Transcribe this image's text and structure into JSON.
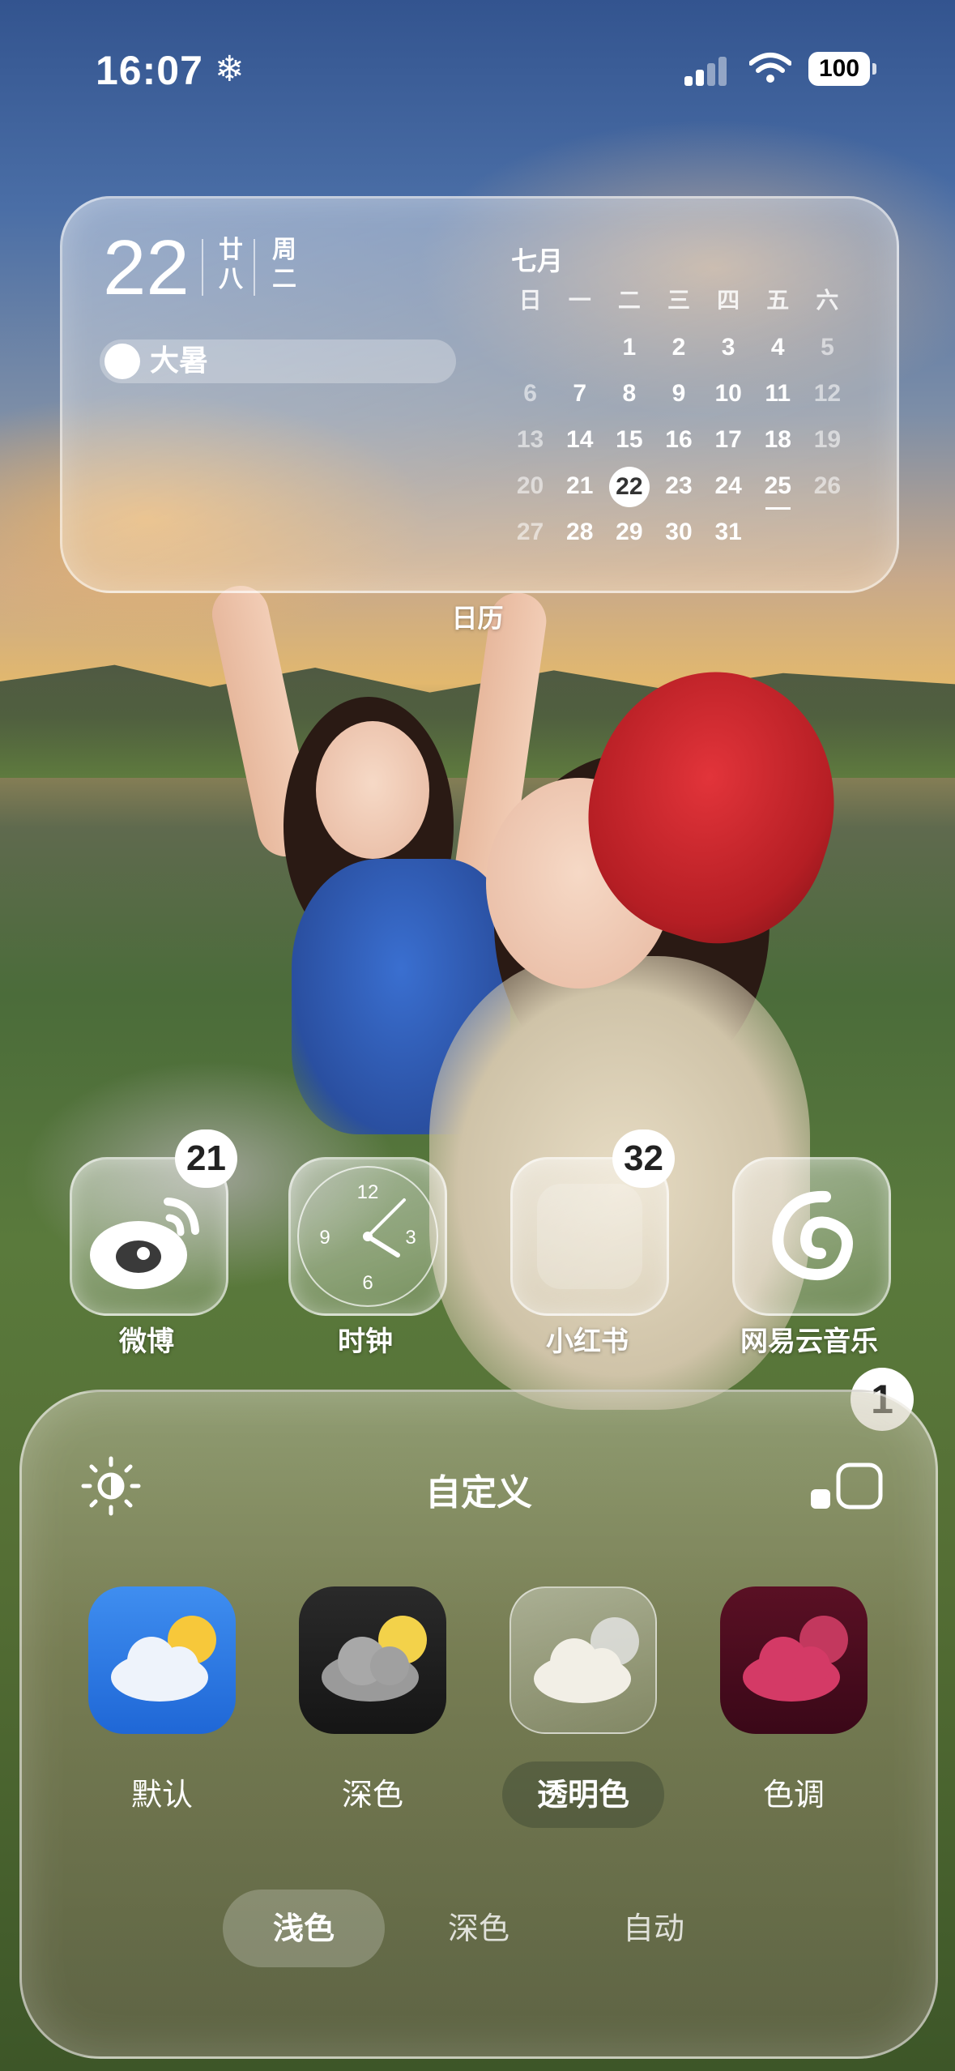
{
  "status_bar": {
    "time": "16:07",
    "focus_icon": "snowflake-icon",
    "battery": "100"
  },
  "calendar_widget": {
    "day": "22",
    "lunar_date": [
      "廿",
      "八"
    ],
    "weekday": [
      "周",
      "二"
    ],
    "solar_term": "大暑",
    "month": "七月",
    "weekday_headers": [
      "日",
      "一",
      "二",
      "三",
      "四",
      "五",
      "六"
    ],
    "weeks": [
      [
        "",
        "",
        "1",
        "2",
        "3",
        "4",
        "5"
      ],
      [
        "6",
        "7",
        "8",
        "9",
        "10",
        "11",
        "12"
      ],
      [
        "13",
        "14",
        "15",
        "16",
        "17",
        "18",
        "19"
      ],
      [
        "20",
        "21",
        "22",
        "23",
        "24",
        "25",
        "26"
      ],
      [
        "27",
        "28",
        "29",
        "30",
        "31",
        "",
        ""
      ]
    ],
    "today": "22",
    "marked_day": "25",
    "label": "日历"
  },
  "apps": [
    {
      "name": "微博",
      "icon": "weibo-icon",
      "badge": "21"
    },
    {
      "name": "时钟",
      "icon": "clock-icon",
      "badge": ""
    },
    {
      "name": "小红书",
      "icon": "xiaohongshu-icon",
      "badge": "32"
    },
    {
      "name": "网易云音乐",
      "icon": "netease-music-icon",
      "badge": ""
    }
  ],
  "clock_numbers": [
    "12",
    "3",
    "6",
    "9"
  ],
  "customize_panel": {
    "title": "自定义",
    "brightness_icon": "brightness-icon",
    "size_icon": "icon-size-icon",
    "styles": [
      {
        "label": "默认",
        "selected": false
      },
      {
        "label": "深色",
        "selected": false
      },
      {
        "label": "透明色",
        "selected": true
      },
      {
        "label": "色调",
        "selected": false
      }
    ],
    "modes": [
      {
        "label": "浅色",
        "selected": true
      },
      {
        "label": "深色",
        "selected": false
      },
      {
        "label": "自动",
        "selected": false
      }
    ],
    "dismiss_badge": "1"
  }
}
